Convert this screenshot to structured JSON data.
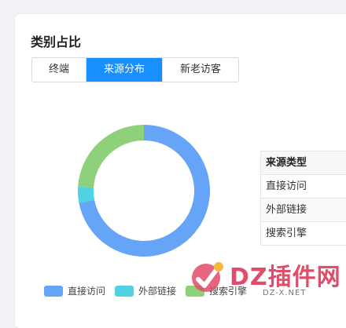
{
  "panel": {
    "title": "类别占比"
  },
  "tabs": [
    {
      "label": "终端",
      "active": false
    },
    {
      "label": "来源分布",
      "active": true
    },
    {
      "label": "新老访客",
      "active": false
    }
  ],
  "chart_data": {
    "type": "pie",
    "variant": "donut",
    "categories": [
      "直接访问",
      "外部链接",
      "搜索引擎"
    ],
    "values": [
      72,
      4,
      24
    ],
    "colors": [
      "#65a4f7",
      "#4fd2e3",
      "#8fd17a"
    ],
    "legend_position": "bottom-left"
  },
  "source_table": {
    "header": "来源类型",
    "rows": [
      "直接访问",
      "外部链接",
      "搜索引擎"
    ]
  },
  "legend": [
    {
      "label": "直接访问",
      "color": "#65a4f7"
    },
    {
      "label": "外部链接",
      "color": "#4fd2e3"
    },
    {
      "label": "搜索引擎",
      "color": "#8fd17a"
    }
  ],
  "watermark": {
    "text": "DZ插件网",
    "sub": "DZ-X.NET"
  }
}
